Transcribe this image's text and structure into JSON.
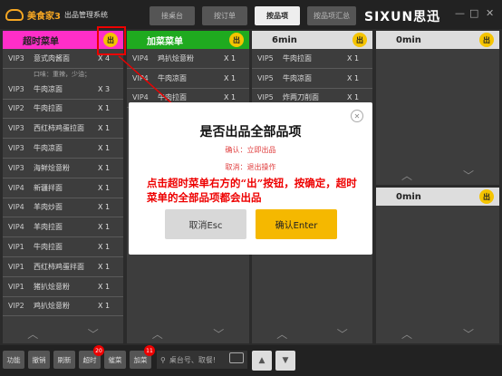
{
  "app": {
    "name": "美食家3",
    "subtitle": "出品管理系统",
    "brand": "SIXUN思迅",
    "tabs": [
      "接桌台",
      "按订单",
      "按品项",
      "按品项汇总"
    ],
    "window_controls": [
      "—",
      "□",
      "✕"
    ]
  },
  "columns": [
    {
      "title": "超时菜单",
      "header_color": "#ff2ec8",
      "chu": "出",
      "rows": [
        {
          "table": "VIP3",
          "name": "意式肉酱面",
          "qty": "X 4"
        },
        {
          "note": "口味：重辣，少油；"
        },
        {
          "table": "VIP3",
          "name": "牛肉凉面",
          "qty": "X 3"
        },
        {
          "table": "VIP2",
          "name": "牛肉拉面",
          "qty": "X 1"
        },
        {
          "table": "VIP3",
          "name": "西红柿鸡蛋拉面",
          "qty": "X 1"
        },
        {
          "table": "VIP3",
          "name": "牛肉凉面",
          "qty": "X 1"
        },
        {
          "table": "VIP3",
          "name": "海鲜烩意粉",
          "qty": "X 1"
        },
        {
          "table": "VIP4",
          "name": "新疆拌面",
          "qty": "X 1"
        },
        {
          "table": "VIP4",
          "name": "羊肉炒面",
          "qty": "X 1"
        },
        {
          "table": "VIP4",
          "name": "羊肉拉面",
          "qty": "X 1"
        },
        {
          "table": "VIP1",
          "name": "牛肉拉面",
          "qty": "X 1"
        },
        {
          "table": "VIP1",
          "name": "西红柿鸡蛋拌面",
          "qty": "X 1"
        },
        {
          "table": "VIP1",
          "name": "猪扒烩意粉",
          "qty": "X 1"
        },
        {
          "table": "VIP2",
          "name": "鸡扒烩意粉",
          "qty": "X 1"
        }
      ]
    },
    {
      "title": "加菜菜单",
      "header_color": "#1faa1f",
      "chu": "出",
      "rows": [
        {
          "table": "VIP4",
          "name": "鸡扒烩意粉",
          "qty": "X 1"
        },
        {
          "table": "VIP4",
          "name": "牛肉凉面",
          "qty": "X 1"
        },
        {
          "table": "VIP4",
          "name": "牛肉拉面",
          "qty": "X 1"
        }
      ]
    },
    {
      "title": "6min",
      "header_color": "#dddddd",
      "chu": "出",
      "rows": [
        {
          "table": "VIP5",
          "name": "牛肉拉面",
          "qty": "X 1"
        },
        {
          "table": "VIP5",
          "name": "牛肉凉面",
          "qty": "X 1"
        },
        {
          "table": "VIP5",
          "name": "炸两刀削面",
          "qty": "X 1"
        }
      ]
    },
    {
      "title": "0min",
      "header_color": "#dddddd",
      "chu": "出",
      "rows": []
    },
    {
      "title": "0min",
      "header_color": "#dddddd",
      "chu": "出",
      "rows": []
    }
  ],
  "dialog": {
    "title": "是否出品全部品项",
    "line1": "确认：立即出品",
    "line2": "取消：退出操作",
    "annotation": "点击超时菜单右方的“出”按钮，按确定，超时菜单的全部品项都会出品",
    "cancel_label": "取消Esc",
    "ok_label": "确认Enter",
    "close_glyph": "✕"
  },
  "footer_glyphs": {
    "up": "︿",
    "down": "﹀"
  },
  "bottom": {
    "buttons": [
      {
        "label": "功能"
      },
      {
        "label": "撤销"
      },
      {
        "label": "刷新"
      },
      {
        "label": "超时",
        "badge": "20"
      },
      {
        "label": "催菜"
      },
      {
        "label": "加菜",
        "badge": "11"
      }
    ],
    "search_placeholder": "桌台号、取餐!",
    "nav_up": "▲",
    "nav_down": "▼"
  },
  "colors": {
    "accent": "#f5b800",
    "annotation_red": "#ee0000"
  }
}
